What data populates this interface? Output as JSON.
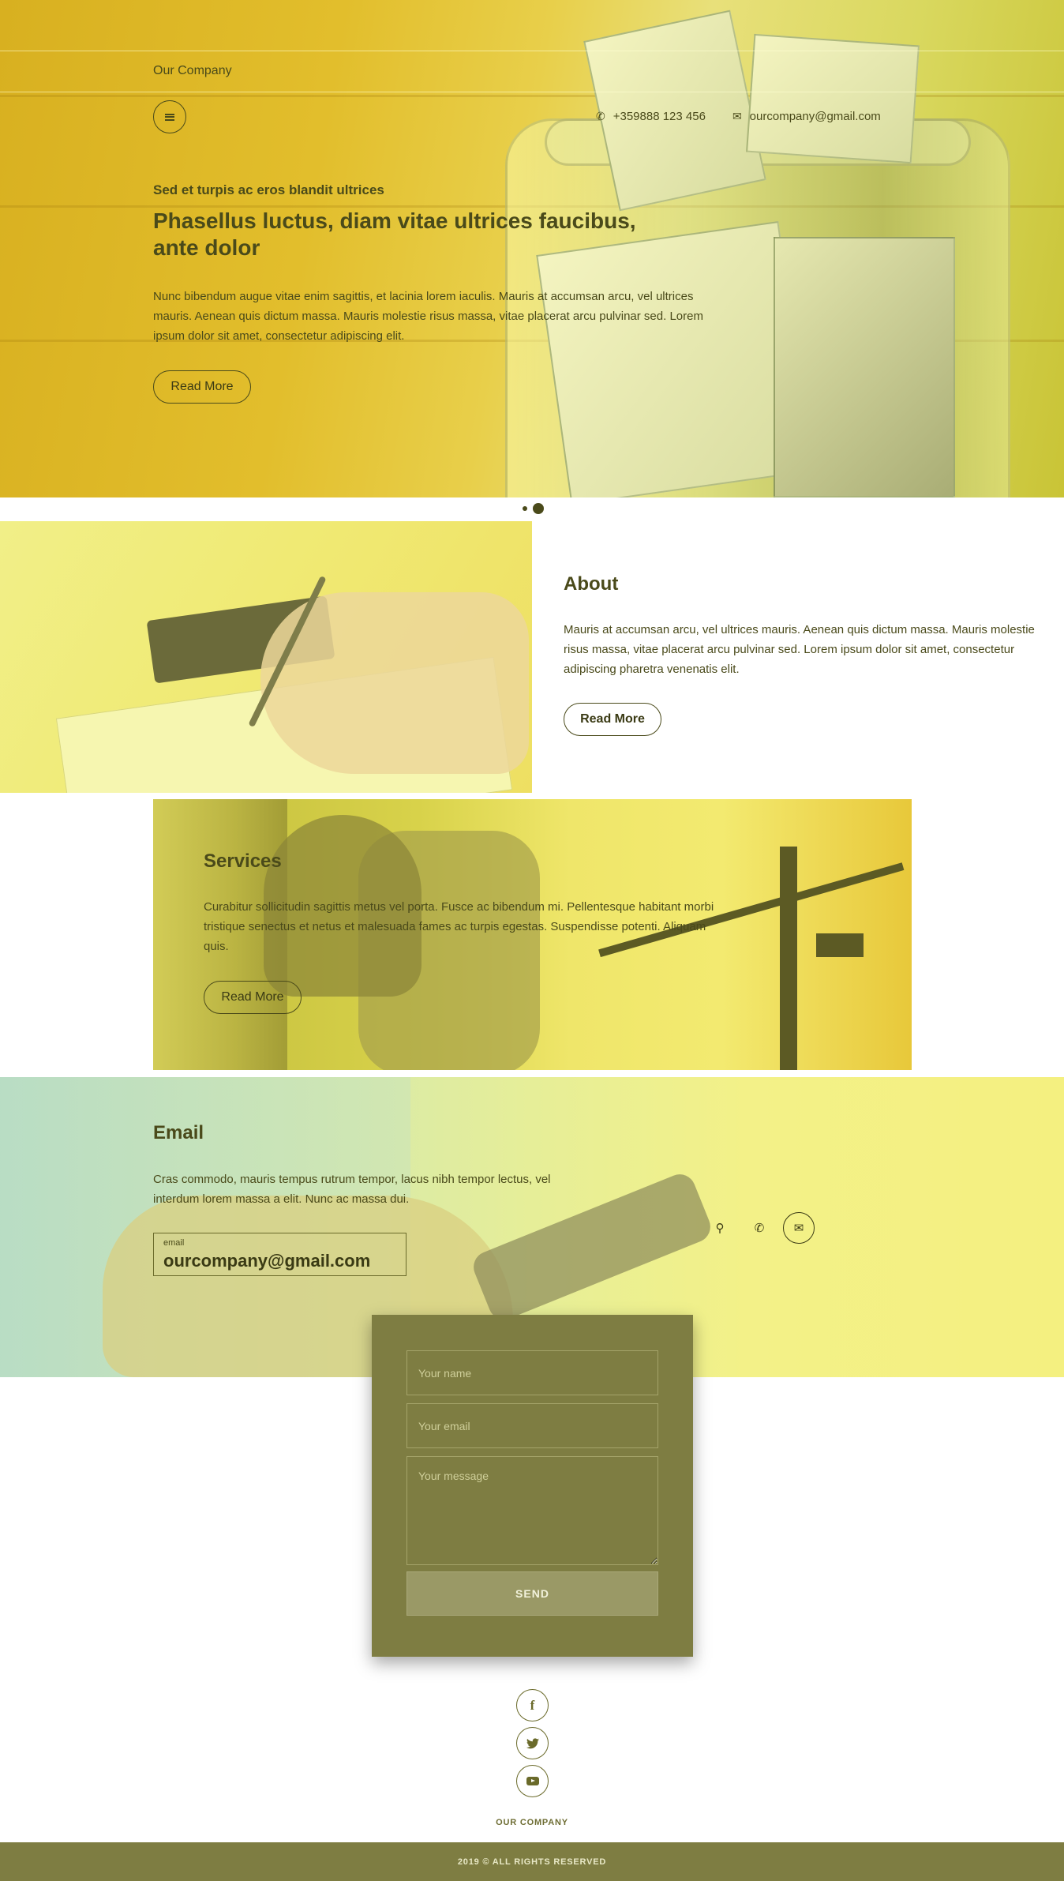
{
  "header": {
    "brand": "Our Company",
    "phone": "+359888 123 456",
    "email": "ourcompany@gmail.com",
    "icons": {
      "menu": "menu-icon",
      "phone": "phone-icon",
      "email": "envelope-icon"
    }
  },
  "hero": {
    "subtitle": "Sed et turpis ac eros blandit ultrices",
    "title": "Phasellus luctus, diam vitae ultrices faucibus, ante dolor",
    "text": "Nunc bibendum augue vitae enim sagittis, et lacinia lorem iaculis. Mauris at accumsan arcu, vel ultrices mauris. Aenean quis dictum massa. Mauris molestie risus massa, vitae placerat arcu pulvinar sed. Lorem ipsum dolor sit amet, consectetur adipiscing elit.",
    "button": "Read More",
    "slides": {
      "count": 2,
      "active": 2
    }
  },
  "about": {
    "title": "About",
    "text": "Mauris at accumsan arcu, vel ultrices mauris. Aenean quis dictum massa. Mauris molestie risus massa, vitae placerat arcu pulvinar sed. Lorem ipsum dolor sit amet, consectetur adipiscing pharetra venenatis elit.",
    "button": "Read More"
  },
  "services": {
    "title": "Services",
    "text": "Curabitur sollicitudin sagittis metus vel porta. Fusce ac bibendum mi. Pellentesque habitant morbi tristique senectus et netus et malesuada fames ac turpis egestas. Suspendisse potenti. Aliquam quis.",
    "button": "Read More"
  },
  "email_section": {
    "title": "Email",
    "text": "Cras commodo, mauris tempus rutrum tempor, lacus nibh tempor lectus, vel interdum lorem massa a elit. Nunc ac massa dui.",
    "field_label": "email",
    "field_value": "ourcompany@gmail.com",
    "icons": [
      "map-pin-icon",
      "phone-icon",
      "envelope-icon"
    ]
  },
  "form": {
    "name_placeholder": "Your name",
    "email_placeholder": "Your email",
    "message_placeholder": "Your message",
    "send_label": "SEND"
  },
  "footer": {
    "social": [
      "facebook-icon",
      "twitter-icon",
      "youtube-icon"
    ],
    "brand": "OUR COMPANY",
    "copyright": "2019 © ALL RIGHTS RESERVED"
  },
  "colors": {
    "overlay_yellow": "#e8cf4a",
    "text_dark": "#4a4a1a",
    "olive": "#7e7d42"
  }
}
